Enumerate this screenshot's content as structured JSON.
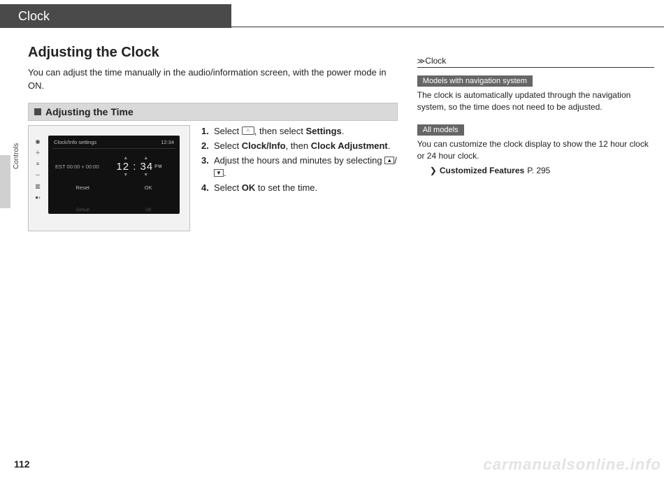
{
  "header": {
    "title": "Clock"
  },
  "main": {
    "section_title": "Adjusting the Clock",
    "intro": "You can adjust the time manually in the audio/information screen, with the power mode in ON.",
    "subheader": "Adjusting the Time",
    "screenshot": {
      "topbar_left": "Clock/Info settings",
      "topbar_right": "12:34",
      "est": "EST 00:00 + 00:00",
      "bigtime": "12 : 34",
      "pm": "PM",
      "btn_reset": "Reset",
      "btn_ok": "OK",
      "foot_left": "Default",
      "foot_right": "OK"
    },
    "steps": {
      "s1a": "Select ",
      "s1_home": "⌂",
      "s1b": ", then select ",
      "s1_bold": "Settings",
      "s1c": ".",
      "s2a": "Select ",
      "s2_b1": "Clock/Info",
      "s2b": ", then ",
      "s2_b2": "Clock Adjustment",
      "s2c": ".",
      "s3a": "Adjust the hours and minutes by selecting ",
      "s3_up": "▲",
      "s3_slash": "/",
      "s3_down": "▼",
      "s3b": ".",
      "s4a": "Select ",
      "s4_b": "OK",
      "s4b": " to set the time."
    }
  },
  "side": {
    "header": "Clock",
    "badge1": "Models with navigation system",
    "text1": "The clock is automatically updated through the navigation system, so the time does not need to be adjusted.",
    "badge2": "All models",
    "text2": "You can customize the clock display to show the 12 hour clock or 24 hour clock.",
    "link_label": "Customized Features",
    "link_page": "P. 295"
  },
  "vtab": "Controls",
  "page_number": "112",
  "watermark": "carmanualsonline.info"
}
